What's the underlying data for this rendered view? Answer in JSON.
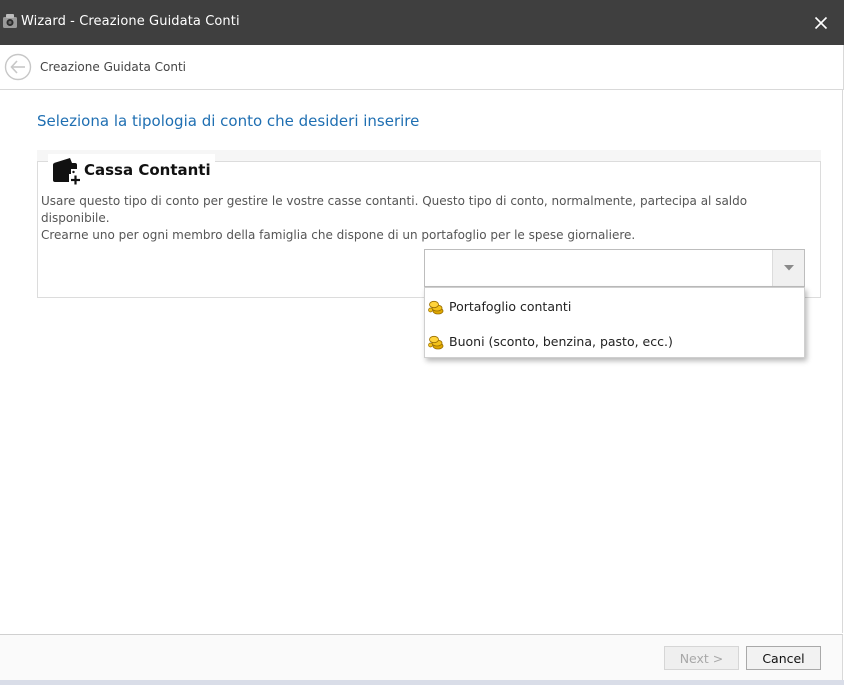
{
  "window": {
    "title": "Wizard - Creazione Guidata Conti",
    "icon": "camera-icon"
  },
  "nav": {
    "breadcrumb": "Creazione Guidata Conti",
    "back_icon": "back-arrow-icon"
  },
  "page": {
    "heading": "Seleziona la tipologia di conto che desideri inserire",
    "heading_color": "#1f6fb2"
  },
  "account_group": {
    "icon": "wallet-add-icon",
    "title": "Cassa Contanti",
    "description_line1": "Usare questo tipo di conto per gestire le vostre casse contanti. Questo tipo di conto, normalmente, partecipa al saldo disponibile.",
    "description_line2": "Crearne uno per ogni membro della famiglia che dispone di un portafoglio per le spese giornaliere.",
    "combo_value": ""
  },
  "dropdown": {
    "options": [
      {
        "label": "Portafoglio contanti",
        "icon": "coins-icon"
      },
      {
        "label": "Buoni (sconto, benzina, pasto, ecc.)",
        "icon": "coins-icon"
      }
    ]
  },
  "footer": {
    "next_label": "Next >",
    "cancel_label": "Cancel",
    "next_enabled": false
  }
}
